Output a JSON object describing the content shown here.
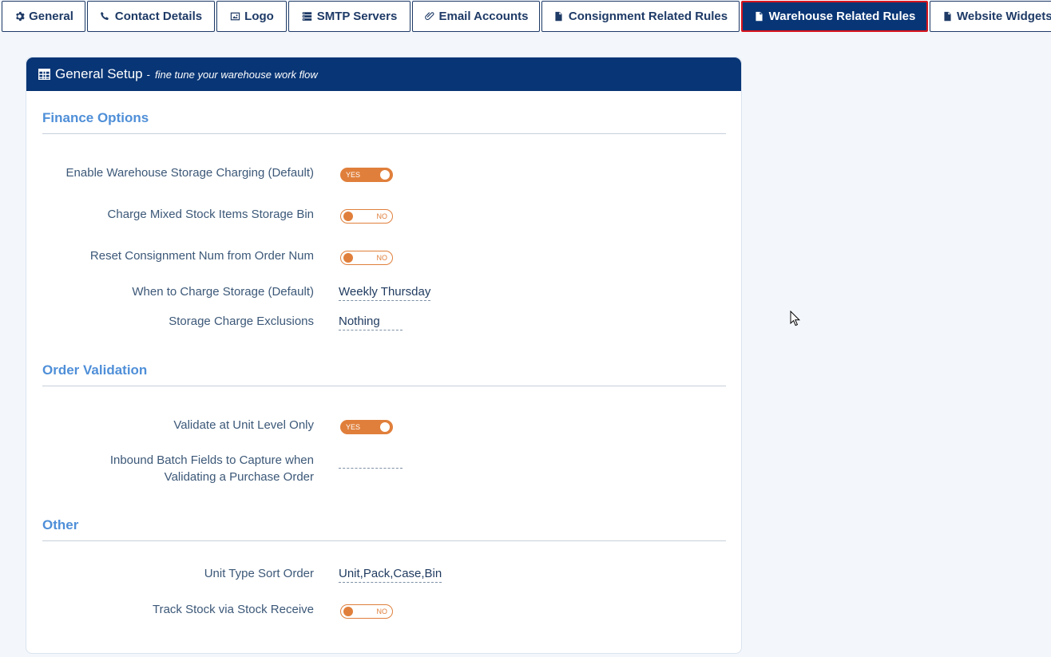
{
  "tabs": [
    {
      "label": "General",
      "icon": "gear-icon"
    },
    {
      "label": "Contact Details",
      "icon": "phone-icon"
    },
    {
      "label": "Logo",
      "icon": "image-icon"
    },
    {
      "label": "SMTP Servers",
      "icon": "server-icon"
    },
    {
      "label": "Email Accounts",
      "icon": "paperclip-icon"
    },
    {
      "label": "Consignment Related Rules",
      "icon": "file-icon"
    },
    {
      "label": "Warehouse Related Rules",
      "icon": "file-icon",
      "active": true
    },
    {
      "label": "Website Widgets",
      "icon": "file-icon"
    }
  ],
  "panel": {
    "title": "General Setup",
    "separator": "-",
    "subtitle": "fine tune your warehouse work flow"
  },
  "sections": {
    "finance": "Finance Options",
    "order": "Order Validation",
    "other": "Other"
  },
  "fields": {
    "enable_storage_charging": {
      "label": "Enable Warehouse Storage Charging (Default)",
      "value": "YES"
    },
    "charge_mixed_bin": {
      "label": "Charge Mixed Stock Items Storage Bin",
      "value": "NO"
    },
    "reset_consignment_num": {
      "label": "Reset Consignment Num from Order Num",
      "value": "NO"
    },
    "when_to_charge": {
      "label": "When to Charge Storage (Default)",
      "value": "Weekly Thursday"
    },
    "storage_exclusions": {
      "label": "Storage Charge Exclusions",
      "value": "Nothing"
    },
    "validate_unit_level": {
      "label": "Validate at Unit Level Only",
      "value": "YES"
    },
    "inbound_batch_fields": {
      "label_line1": "Inbound Batch Fields to Capture when",
      "label_line2": "Validating a Purchase Order",
      "value": ""
    },
    "unit_type_sort": {
      "label": "Unit Type Sort Order",
      "value": "Unit,Pack,Case,Bin"
    },
    "track_stock_receive": {
      "label": "Track Stock via Stock Receive",
      "value": "NO"
    }
  },
  "colors": {
    "accent_navy": "#083575",
    "active_tab_border": "#d8141c",
    "toggle_orange": "#e07f3b",
    "section_blue": "#4f8fd8"
  }
}
